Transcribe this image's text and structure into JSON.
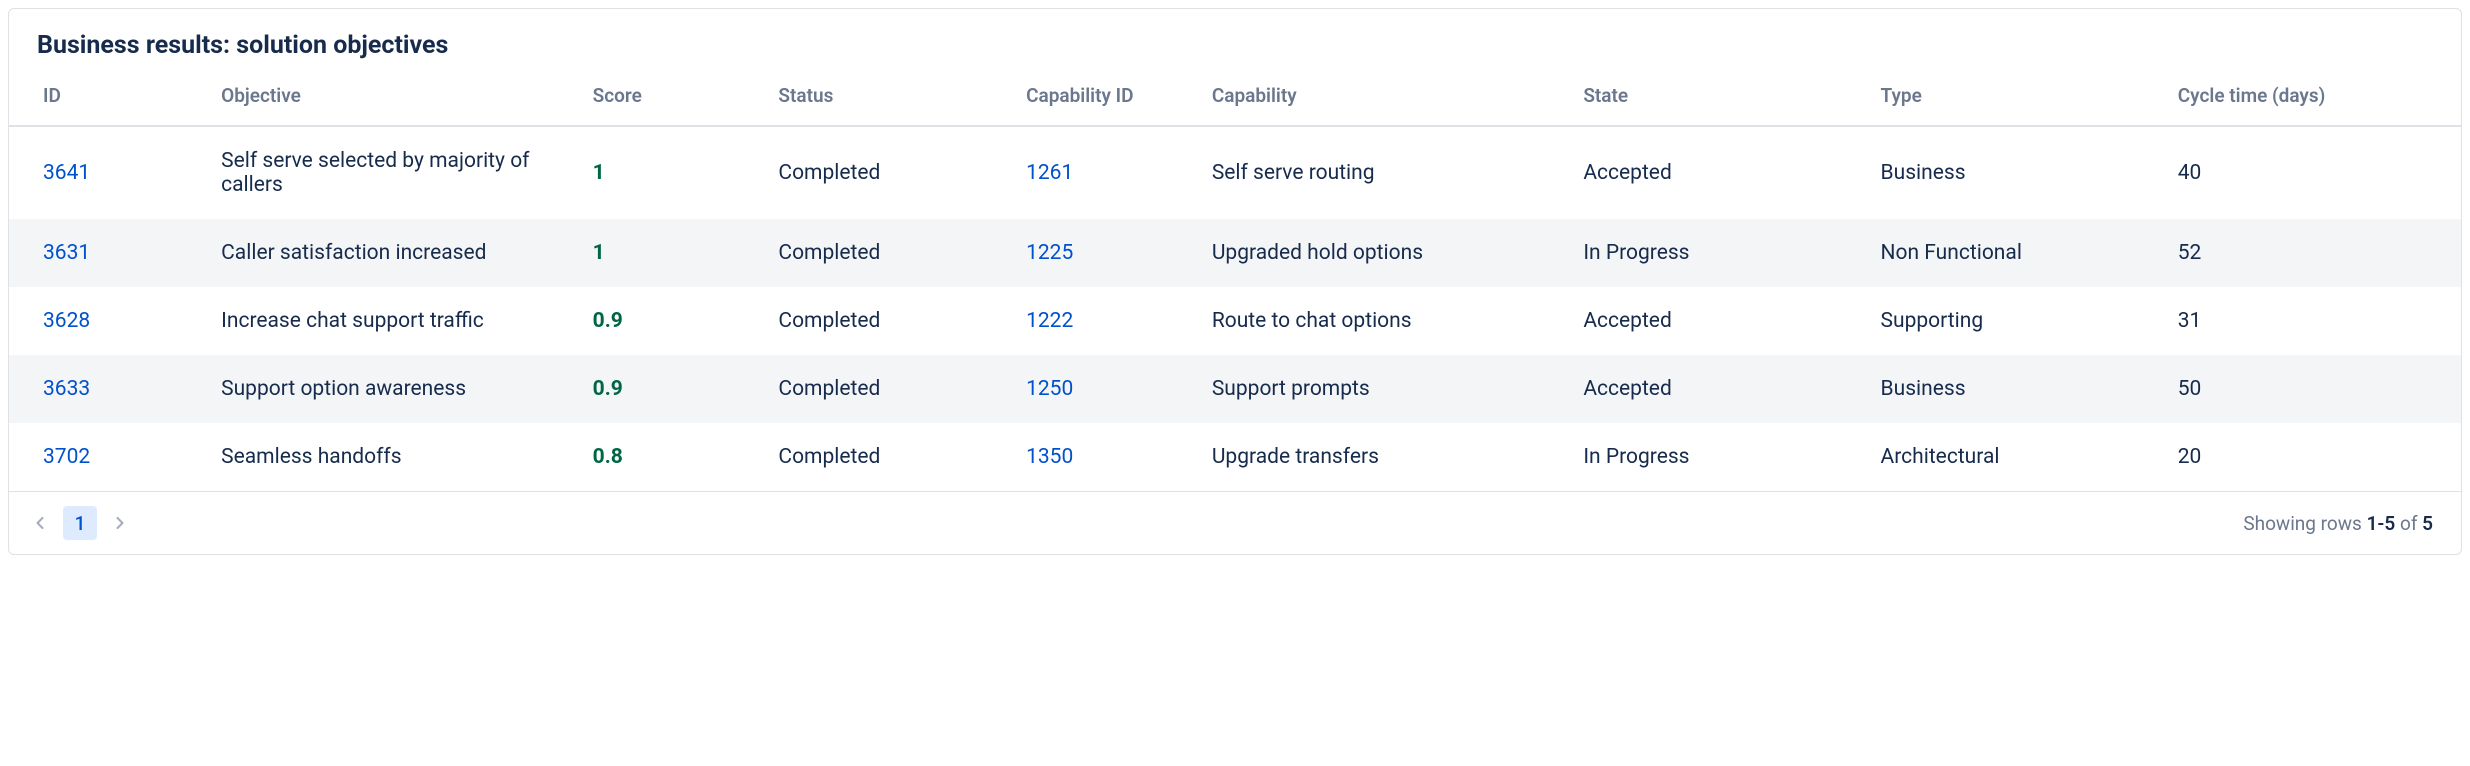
{
  "title": "Business results: solution objectives",
  "columns": {
    "id": "ID",
    "objective": "Objective",
    "score": "Score",
    "status": "Status",
    "capability_id": "Capability ID",
    "capability": "Capability",
    "state": "State",
    "type": "Type",
    "cycle_time": "Cycle time (days)"
  },
  "rows": [
    {
      "id": "3641",
      "objective": "Self serve selected by majority of callers",
      "score": "1",
      "status": "Completed",
      "capability_id": "1261",
      "capability": "Self serve routing",
      "state": "Accepted",
      "type": "Business",
      "cycle_time": "40"
    },
    {
      "id": "3631",
      "objective": "Caller satisfaction increased",
      "score": "1",
      "status": "Completed",
      "capability_id": "1225",
      "capability": "Upgraded hold options",
      "state": "In Progress",
      "type": "Non Functional",
      "cycle_time": "52"
    },
    {
      "id": "3628",
      "objective": "Increase chat support traffic",
      "score": "0.9",
      "status": "Completed",
      "capability_id": "1222",
      "capability": "Route to chat options",
      "state": "Accepted",
      "type": "Supporting",
      "cycle_time": "31"
    },
    {
      "id": "3633",
      "objective": "Support option awareness",
      "score": "0.9",
      "status": "Completed",
      "capability_id": "1250",
      "capability": "Support prompts",
      "state": "Accepted",
      "type": "Business",
      "cycle_time": "50"
    },
    {
      "id": "3702",
      "objective": "Seamless handoffs",
      "score": "0.8",
      "status": "Completed",
      "capability_id": "1350",
      "capability": "Upgrade transfers",
      "state": "In Progress",
      "type": "Architectural",
      "cycle_time": "20"
    }
  ],
  "pagination": {
    "current": "1",
    "showing_prefix": "Showing rows ",
    "range": "1-5",
    "of": " of ",
    "total": "5"
  }
}
